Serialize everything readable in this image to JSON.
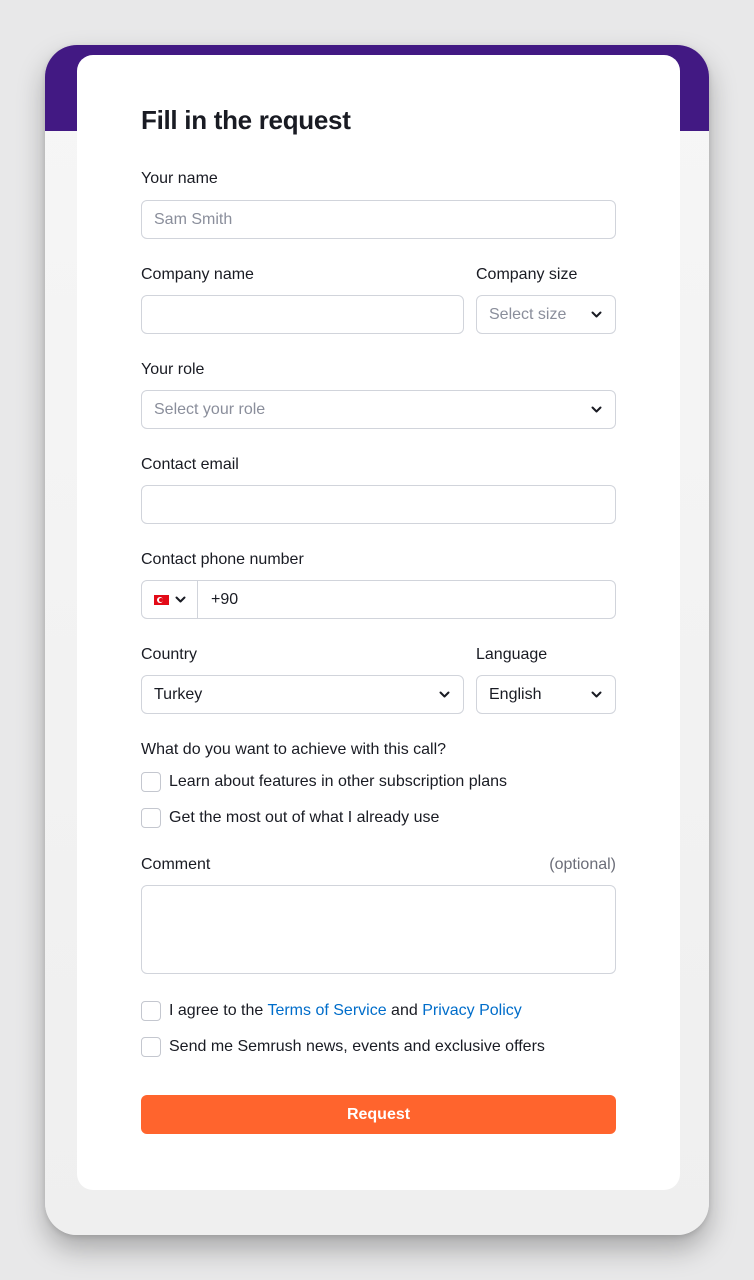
{
  "form": {
    "title": "Fill in the request",
    "name": {
      "label": "Your name",
      "placeholder": "Sam Smith",
      "value": ""
    },
    "company_name": {
      "label": "Company name",
      "value": ""
    },
    "company_size": {
      "label": "Company size",
      "placeholder": "Select size"
    },
    "role": {
      "label": "Your role",
      "placeholder": "Select your role"
    },
    "email": {
      "label": "Contact email",
      "value": ""
    },
    "phone": {
      "label": "Contact phone number",
      "country_flag": "turkey-flag-icon",
      "value": "+90"
    },
    "country": {
      "label": "Country",
      "value": "Turkey"
    },
    "language": {
      "label": "Language",
      "value": "English"
    },
    "goals": {
      "question": "What do you want to achieve with this call?",
      "options": [
        {
          "label": "Learn about features in other subscription plans",
          "checked": false
        },
        {
          "label": "Get the most out of what I already use",
          "checked": false
        }
      ]
    },
    "comment": {
      "label": "Comment",
      "optional_label": "(optional)",
      "value": ""
    },
    "agree": {
      "prefix": "I agree to the ",
      "terms_link": "Terms of Service",
      "middle": " and ",
      "privacy_link": "Privacy Policy",
      "checked": false
    },
    "newsletter": {
      "label": "Send me Semrush news, events and exclusive offers",
      "checked": false
    },
    "submit_label": "Request"
  },
  "colors": {
    "brand_purple": "#421983",
    "submit_orange": "#ff642d",
    "link_blue": "#006dca"
  }
}
